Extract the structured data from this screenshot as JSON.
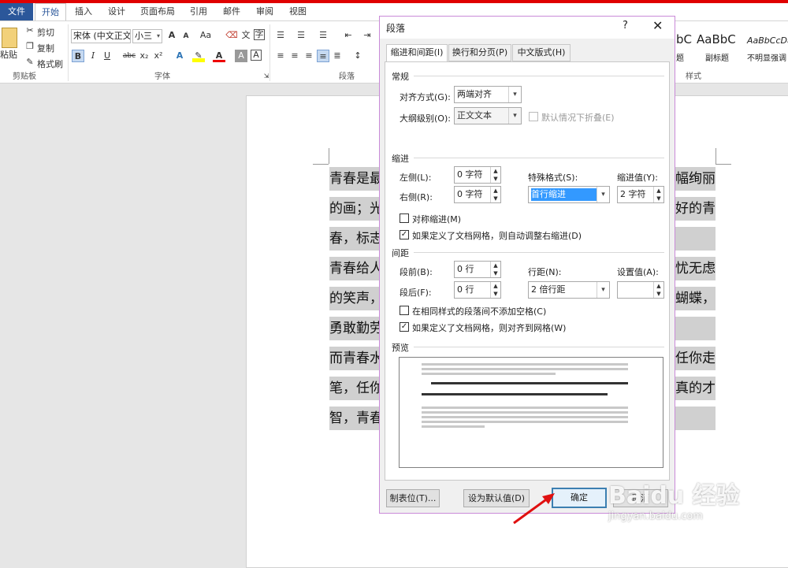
{
  "ribbon": {
    "tabs": [
      "文件",
      "开始",
      "插入",
      "设计",
      "页面布局",
      "引用",
      "邮件",
      "审阅",
      "视图"
    ],
    "clipboard": {
      "paste": "粘贴",
      "cut": "剪切",
      "copy": "复制",
      "format_painter": "格式刷",
      "label": "剪贴板"
    },
    "font": {
      "name": "宋体 (中文正文",
      "size": "小三",
      "label": "字体",
      "bold": "B",
      "italic": "I",
      "underline": "U",
      "strike": "abc",
      "sub": "x₂",
      "sup": "x²",
      "grow": "A",
      "shrink": "A",
      "case": "Aa",
      "phonetic": "文",
      "color_a": "A",
      "enc": "字"
    },
    "paragraph": {
      "label": "段落"
    },
    "styles": {
      "label": "样式",
      "s1": "bC",
      "s2": "AaBbC",
      "s3": "AaBbCcDa",
      "n1": "副标题",
      "n2": "不明显强调",
      "n0": "题"
    }
  },
  "document": {
    "lines": [
      {
        "left": "青春是最",
        "right": "幅绚丽"
      },
      {
        "left": "的画；光",
        "right": "好的青"
      },
      {
        "left": "春，标志",
        "right": ""
      },
      {
        "left": "青春给人",
        "right": "忧无虑"
      },
      {
        "left": "的笑声，",
        "right": "蝴蝶，"
      },
      {
        "left": "勇敢勤劳",
        "right": ""
      },
      {
        "left": "而青春水",
        "right": "任你走"
      },
      {
        "left": "笔，任你",
        "right": "真的才"
      },
      {
        "left": "智，青春",
        "right": ""
      }
    ]
  },
  "dialog": {
    "title": "段落",
    "help": "?",
    "close": "✕",
    "tabs": [
      "缩进和间距(I)",
      "换行和分页(P)",
      "中文版式(H)"
    ],
    "general": {
      "section": "常规",
      "align_label": "对齐方式(G):",
      "align_value": "两端对齐",
      "outline_label": "大纲级别(O):",
      "outline_value": "正文文本",
      "collapse_label": "默认情况下折叠(E)"
    },
    "indent": {
      "section": "缩进",
      "left_label": "左侧(L):",
      "left_value": "0 字符",
      "right_label": "右侧(R):",
      "right_value": "0 字符",
      "special_label": "特殊格式(S):",
      "special_value": "首行缩进",
      "by_label": "缩进值(Y):",
      "by_value": "2 字符",
      "mirror_label": "对称缩进(M)",
      "mirror_checked": false,
      "auto_label": "如果定义了文档网格，则自动调整右缩进(D)",
      "auto_checked": true
    },
    "spacing": {
      "section": "间距",
      "before_label": "段前(B):",
      "before_value": "0 行",
      "after_label": "段后(F):",
      "after_value": "0 行",
      "line_label": "行距(N):",
      "line_value": "2 倍行距",
      "at_label": "设置值(A):",
      "at_value": "",
      "nospace_label": "在相同样式的段落间不添加空格(C)",
      "nospace_checked": false,
      "grid_label": "如果定义了文档网格，则对齐到网格(W)",
      "grid_checked": true
    },
    "preview": {
      "section": "预览"
    },
    "buttons": {
      "tabs": "制表位(T)...",
      "default": "设为默认值(D)",
      "ok": "确定",
      "cancel": "取消"
    }
  },
  "watermark": {
    "brand": "Baidu 经验",
    "url": "jingyan.baidu.com"
  },
  "colors": {
    "accent": "#2b579a",
    "dialog_border": "#c98ad8",
    "highlight": "#3399ff",
    "arrow": "#e01010"
  }
}
